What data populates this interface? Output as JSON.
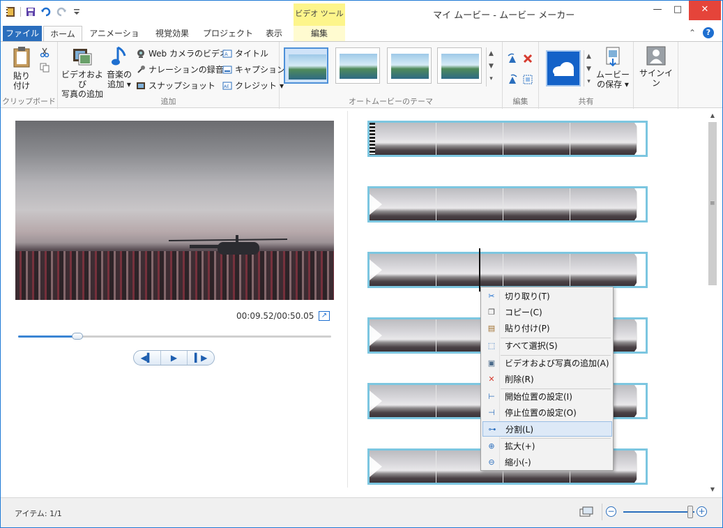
{
  "window": {
    "title": "マイ ムービー - ムービー メーカー",
    "context_tab_header": "ビデオ ツール",
    "minimize": "—",
    "maximize": "□",
    "close": "✕"
  },
  "tabs": [
    "ファイル",
    "ホーム",
    "アニメーション",
    "視覚効果",
    "プロジェクト",
    "表示",
    "編集"
  ],
  "ribbon": {
    "clipboard": {
      "paste_label_1": "貼り",
      "paste_label_2": "付け",
      "group_label": "クリップボード"
    },
    "add": {
      "add_videos_1": "ビデオおよび",
      "add_videos_2": "写真の追加",
      "add_music_1": "音楽の",
      "add_music_2": "追加",
      "webcam": "Web カメラのビデオ",
      "narration": "ナレーションの録音",
      "snapshot": "スナップショット",
      "title": "タイトル",
      "caption": "キャプション",
      "credits": "クレジット",
      "group_label": "追加"
    },
    "themes": {
      "group_label": "オートムービーのテーマ"
    },
    "edit": {
      "group_label": "編集"
    },
    "share": {
      "group_label": "共有",
      "save_movie_1": "ムービー",
      "save_movie_2": "の保存"
    },
    "signin": {
      "label": "サインイン"
    }
  },
  "preview": {
    "time": "00:09.52/00:50.05",
    "progress_fraction": 0.19
  },
  "context_menu": {
    "items": [
      {
        "label": "切り取り(T)",
        "icon": "scissors-icon"
      },
      {
        "label": "コピー(C)",
        "icon": "copy-icon"
      },
      {
        "label": "貼り付け(P)",
        "icon": "paste-icon"
      },
      {
        "label": "すべて選択(S)",
        "icon": "select-all-icon"
      },
      {
        "label": "ビデオおよび写真の追加(A)",
        "icon": "add-media-icon"
      },
      {
        "label": "削除(R)",
        "icon": "delete-icon"
      },
      {
        "label": "開始位置の設定(I)",
        "icon": "set-start-icon"
      },
      {
        "label": "停止位置の設定(O)",
        "icon": "set-end-icon"
      },
      {
        "label": "分割(L)",
        "icon": "split-icon"
      },
      {
        "label": "拡大(+)",
        "icon": "zoom-in-icon"
      },
      {
        "label": "縮小(-)",
        "icon": "zoom-out-icon"
      }
    ]
  },
  "status": {
    "items_text": "アイテム: 1/1",
    "zoom_minus": "−",
    "zoom_plus": "+"
  },
  "colors": {
    "accent": "#2a6ebd",
    "storyboard_border": "#7cc6e0",
    "context_tab": "#fdf58b",
    "close_button": "#e5443a"
  }
}
